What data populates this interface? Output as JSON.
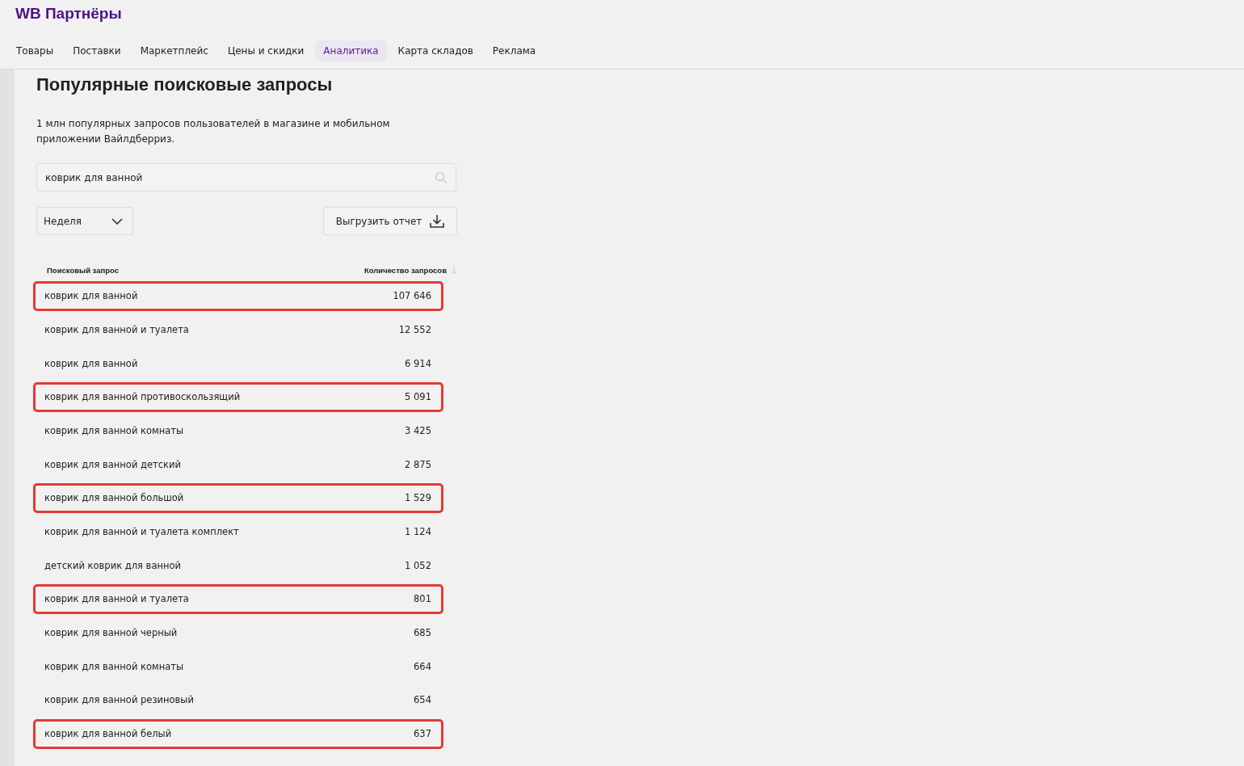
{
  "brand": "WB Партнёры",
  "nav": [
    {
      "label": "Товары",
      "selected": false
    },
    {
      "label": "Поставки",
      "selected": false
    },
    {
      "label": "Маркетплейс",
      "selected": false
    },
    {
      "label": "Цены и скидки",
      "selected": false
    },
    {
      "label": "Аналитика",
      "selected": true
    },
    {
      "label": "Карта складов",
      "selected": false
    },
    {
      "label": "Реклама",
      "selected": false
    }
  ],
  "title": "Популярные поисковые запросы",
  "description": "1 млн популярных запросов пользователей в магазине и мобильном приложении Вайлдберриз.",
  "search": {
    "value": "коврик для ванной"
  },
  "period": "Неделя",
  "export_button": "Выгрузить отчет",
  "table": {
    "columns": [
      "Поисковый запрос",
      "Количество запросов"
    ],
    "rows": [
      {
        "query": "коврик для ванной",
        "count": "107 646",
        "highlighted": true
      },
      {
        "query": "коврик для ванной и туалета",
        "count": "12 552",
        "highlighted": false
      },
      {
        "query": "коврик для ванной",
        "count": "6 914",
        "highlighted": false
      },
      {
        "query": "коврик для ванной противоскользящий",
        "count": "5 091",
        "highlighted": true
      },
      {
        "query": "коврик для ванной комнаты",
        "count": "3 425",
        "highlighted": false
      },
      {
        "query": "коврик для ванной детский",
        "count": "2 875",
        "highlighted": false
      },
      {
        "query": "коврик для ванной большой",
        "count": "1 529",
        "highlighted": true
      },
      {
        "query": "коврик для ванной и туалета комплект",
        "count": "1 124",
        "highlighted": false
      },
      {
        "query": "детский коврик для ванной",
        "count": "1 052",
        "highlighted": false
      },
      {
        "query": "коврик для ванной и туалета",
        "count": "801",
        "highlighted": true
      },
      {
        "query": "коврик для ванной черный",
        "count": "685",
        "highlighted": false
      },
      {
        "query": "коврик для ванной комнаты",
        "count": "664",
        "highlighted": false
      },
      {
        "query": "коврик для ванной резиновый",
        "count": "654",
        "highlighted": false
      },
      {
        "query": "коврик для ванной белый",
        "count": "637",
        "highlighted": true
      }
    ]
  }
}
